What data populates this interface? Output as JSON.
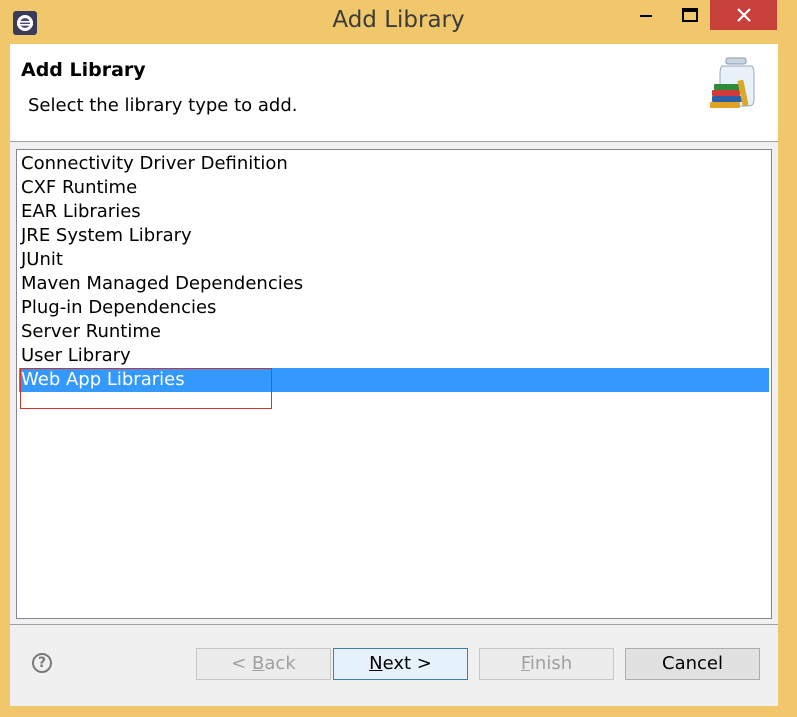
{
  "window": {
    "title": "Add Library",
    "colors": {
      "frame": "#f0c86b",
      "close": "#c7403a",
      "selection": "#3399ff"
    }
  },
  "header": {
    "title": "Add Library",
    "description": "Select the library type to add.",
    "icon": "library-jar-books-icon"
  },
  "list": {
    "items": [
      "Connectivity Driver Definition",
      "CXF Runtime",
      "EAR Libraries",
      "JRE System Library",
      "JUnit",
      "Maven Managed Dependencies",
      "Plug-in Dependencies",
      "Server Runtime",
      "User Library",
      "Web App Libraries"
    ],
    "selected_index": 9
  },
  "footer": {
    "help_icon": "help-icon",
    "help_glyph": "?",
    "back_prefix": "< ",
    "back_mnemonic": "B",
    "back_rest": "ack",
    "next_mnemonic": "N",
    "next_rest": "ext >",
    "finish_mnemonic": "F",
    "finish_rest": "inish",
    "cancel_label": "Cancel"
  }
}
